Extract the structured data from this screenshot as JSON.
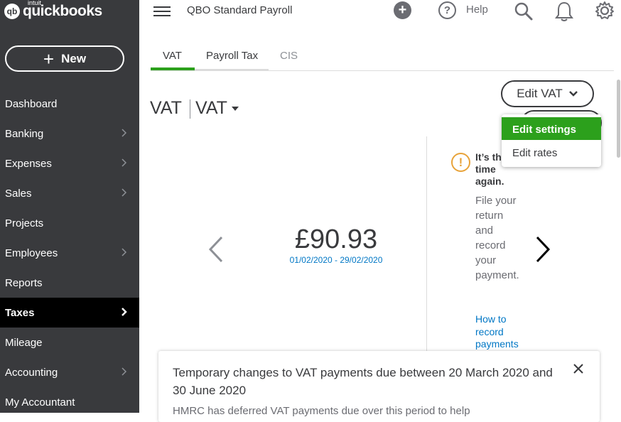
{
  "brand": {
    "intuit": "intuit",
    "name": "quickbooks",
    "mark": "qb"
  },
  "new_button": "New",
  "nav": [
    {
      "label": "Dashboard",
      "chevron": false
    },
    {
      "label": "Banking",
      "chevron": true
    },
    {
      "label": "Expenses",
      "chevron": true
    },
    {
      "label": "Sales",
      "chevron": true
    },
    {
      "label": "Projects",
      "chevron": false
    },
    {
      "label": "Employees",
      "chevron": true
    },
    {
      "label": "Reports",
      "chevron": false
    },
    {
      "label": "Taxes",
      "chevron": true,
      "active": true
    },
    {
      "label": "Mileage",
      "chevron": false
    },
    {
      "label": "Accounting",
      "chevron": true
    },
    {
      "label": "My Accountant",
      "chevron": false
    }
  ],
  "topbar": {
    "company": "QBO Standard Payroll",
    "plus": "+",
    "help_glyph": "?",
    "help": "Help"
  },
  "tabs": [
    {
      "label": "VAT",
      "active": true
    },
    {
      "label": "Payroll Tax"
    },
    {
      "label": "CIS",
      "disabled": true
    }
  ],
  "header": {
    "title": "VAT",
    "dropdown": "VAT",
    "edit_button": "Edit VAT"
  },
  "edit_menu": {
    "items": [
      "Edit settings",
      "Edit rates"
    ]
  },
  "carousel": {
    "amount": "£90.93",
    "period": "01/02/2020 - 29/02/2020"
  },
  "notice": {
    "icon": "!",
    "title": "It’s th time again.",
    "body": "File your return and record your payment.",
    "link": "How to record payments"
  },
  "banner": {
    "title": "Temporary changes to VAT payments due between 20 March 2020 and 30 June 2020",
    "body": "HMRC has deferred VAT payments due over this period to help"
  },
  "colors": {
    "sidebar": "#393a3d",
    "accent": "#2ca01c",
    "link": "#0077c5",
    "warning": "#e8a33a"
  }
}
